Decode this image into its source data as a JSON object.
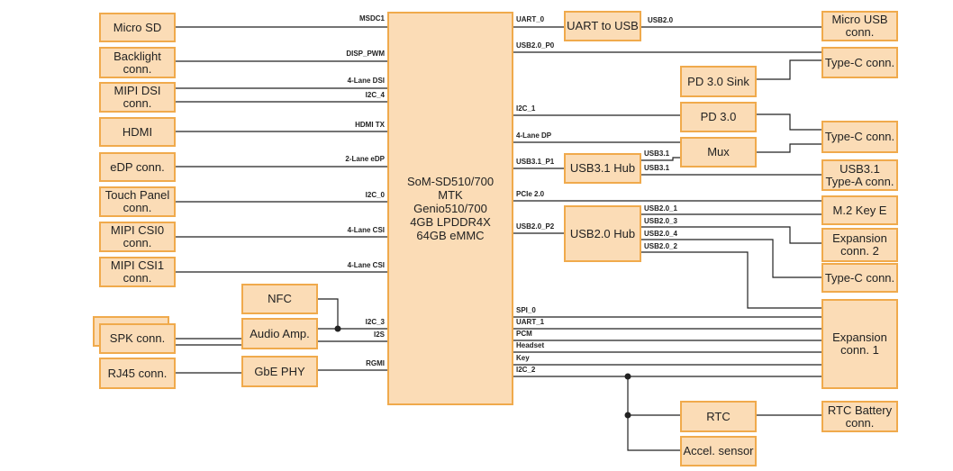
{
  "soc": "SoM-SD510/700\nMTK\nGenio510/700\n4GB LPDDR4X\n64GB eMMC",
  "left": [
    "Micro SD",
    "Backlight\nconn.",
    "MIPI DSI\nconn.",
    "HDMI",
    "eDP conn.",
    "Touch Panel\nconn.",
    "MIPI CSI0\nconn.",
    "MIPI CSI1\nconn.",
    "SPK conn.",
    "RJ45 conn."
  ],
  "mid_left": [
    "NFC",
    "Audio Amp.",
    "GbE PHY"
  ],
  "left_signals": [
    "MSDC1",
    "DISP_PWM",
    "4-Lane DSI",
    "I2C_4",
    "HDMI TX",
    "2-Lane eDP",
    "I2C_0",
    "4-Lane CSI",
    "4-Lane CSI",
    "I2C_3",
    "I2S",
    "RGMI"
  ],
  "mid_right": [
    "UART to USB",
    "PD 3.0 Sink",
    "PD 3.0",
    "Mux",
    "USB3.1 Hub",
    "USB2.0 Hub",
    "RTC",
    "Accel. sensor"
  ],
  "right": [
    "Micro USB\nconn.",
    "Type-C conn.",
    "Type-C conn.",
    "USB3.1\nType-A conn.",
    "M.2 Key E",
    "Expansion\nconn. 2",
    "Type-C conn.",
    "Expansion\nconn. 1",
    "RTC Battery\nconn."
  ],
  "right_signals": [
    "UART_0",
    "USB2.0_P0",
    "I2C_1",
    "4-Lane DP",
    "USB3.1_P1",
    "PCIe 2.0",
    "USB2.0_P2",
    "SPI_0",
    "UART_1",
    "PCM",
    "Headset",
    "Key",
    "I2C_2"
  ],
  "hub_signals": [
    "USB2.0",
    "USB3.1",
    "USB3.1",
    "USB2.0_1",
    "USB2.0_3",
    "USB2.0_4",
    "USB2.0_2"
  ],
  "colors": {
    "fill": "#fbdcb6",
    "border": "#f0aa4c",
    "line": "#222222"
  }
}
